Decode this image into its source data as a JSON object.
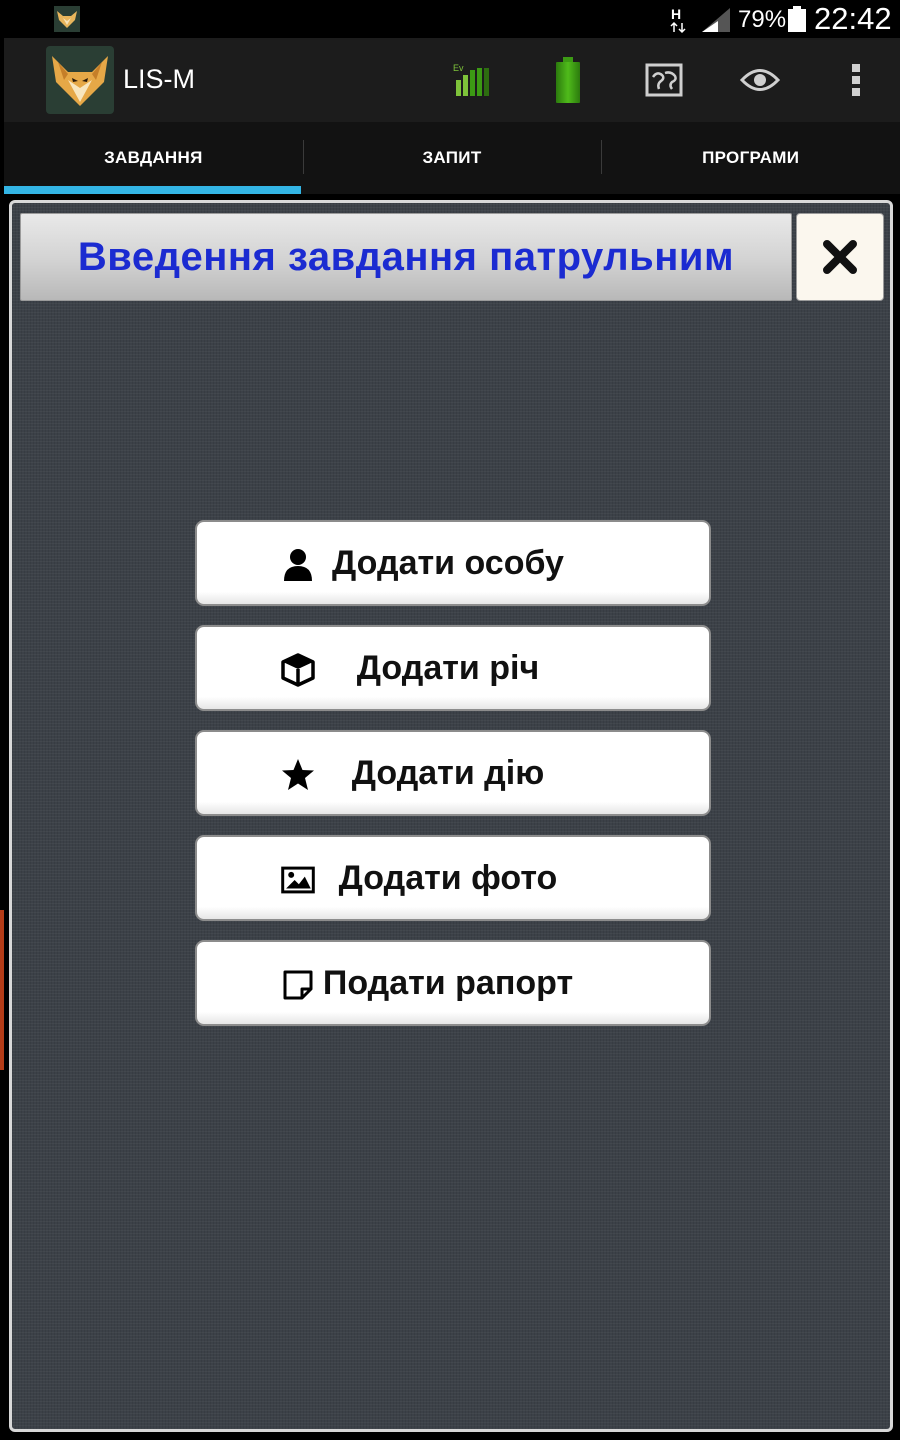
{
  "status_bar": {
    "network_type": "H",
    "battery_percent": "79%",
    "time": "22:42"
  },
  "action_bar": {
    "app_title": "LIS-M",
    "icons": [
      "ev-signal-icon",
      "battery-status-icon",
      "map-icon",
      "eye-icon",
      "overflow-menu-icon"
    ]
  },
  "tabs": [
    {
      "label": "ЗАВДАННЯ",
      "active": true
    },
    {
      "label": "ЗАПИТ",
      "active": false
    },
    {
      "label": "ПРОГРАМИ",
      "active": false
    }
  ],
  "dialog": {
    "title": "Введення завдання патрульним",
    "close_icon": "close-icon",
    "actions": [
      {
        "label": "Додати особу",
        "icon": "person-icon"
      },
      {
        "label": "Додати річ",
        "icon": "cube-icon"
      },
      {
        "label": "Додати дію",
        "icon": "star-icon"
      },
      {
        "label": "Додати фото",
        "icon": "image-icon"
      },
      {
        "label": "Подати рапорт",
        "icon": "note-icon"
      }
    ]
  },
  "colors": {
    "accent": "#33b5e5",
    "title_blue": "#1b2bd1",
    "battery_green": "#3c9a14"
  }
}
